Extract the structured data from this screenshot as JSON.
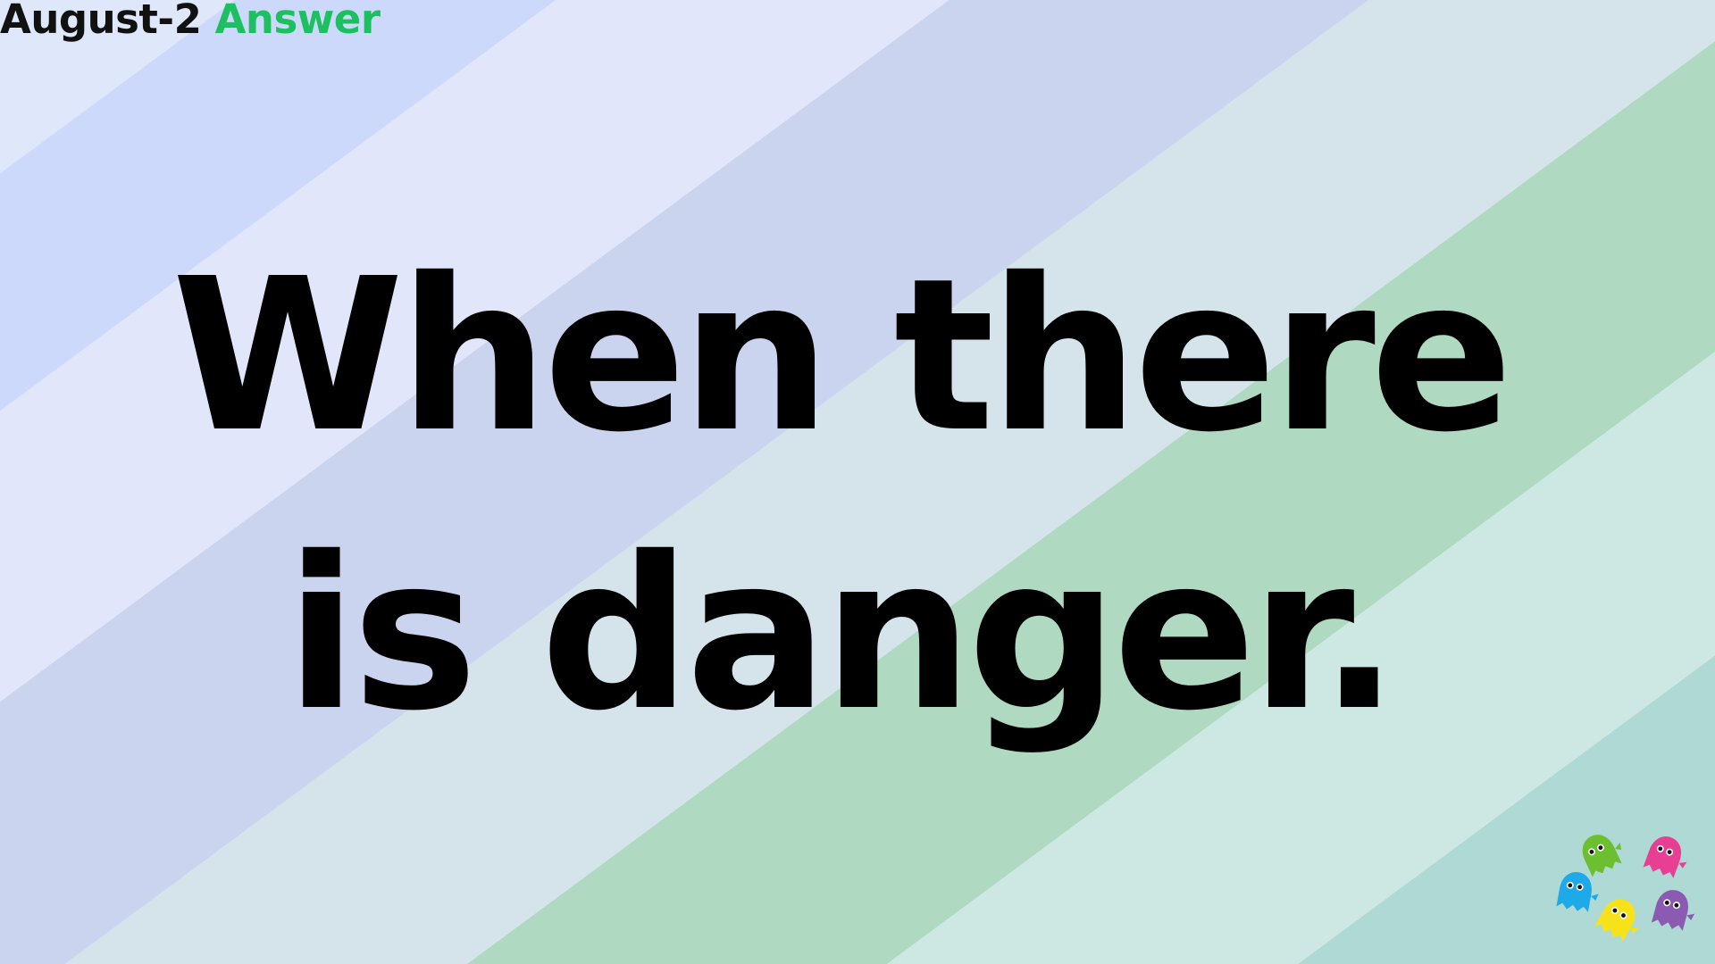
{
  "header": {
    "date_label": "August-2",
    "answer_label": "Answer",
    "answer_color": "#1dbf60"
  },
  "answer": {
    "line1": "When there",
    "line2": "is danger."
  },
  "background": {
    "stripe_colors": [
      "#dfe8fb",
      "#ccd9fb",
      "#e1e6fa",
      "#cad4ee",
      "#d4e4ea",
      "#afd9c0",
      "#cde7e2",
      "#aed9d4"
    ]
  },
  "mascots": {
    "colors": [
      "#6cbf2e",
      "#e83f95",
      "#1ea9e8",
      "#f7e21a",
      "#8a5bb0"
    ]
  }
}
